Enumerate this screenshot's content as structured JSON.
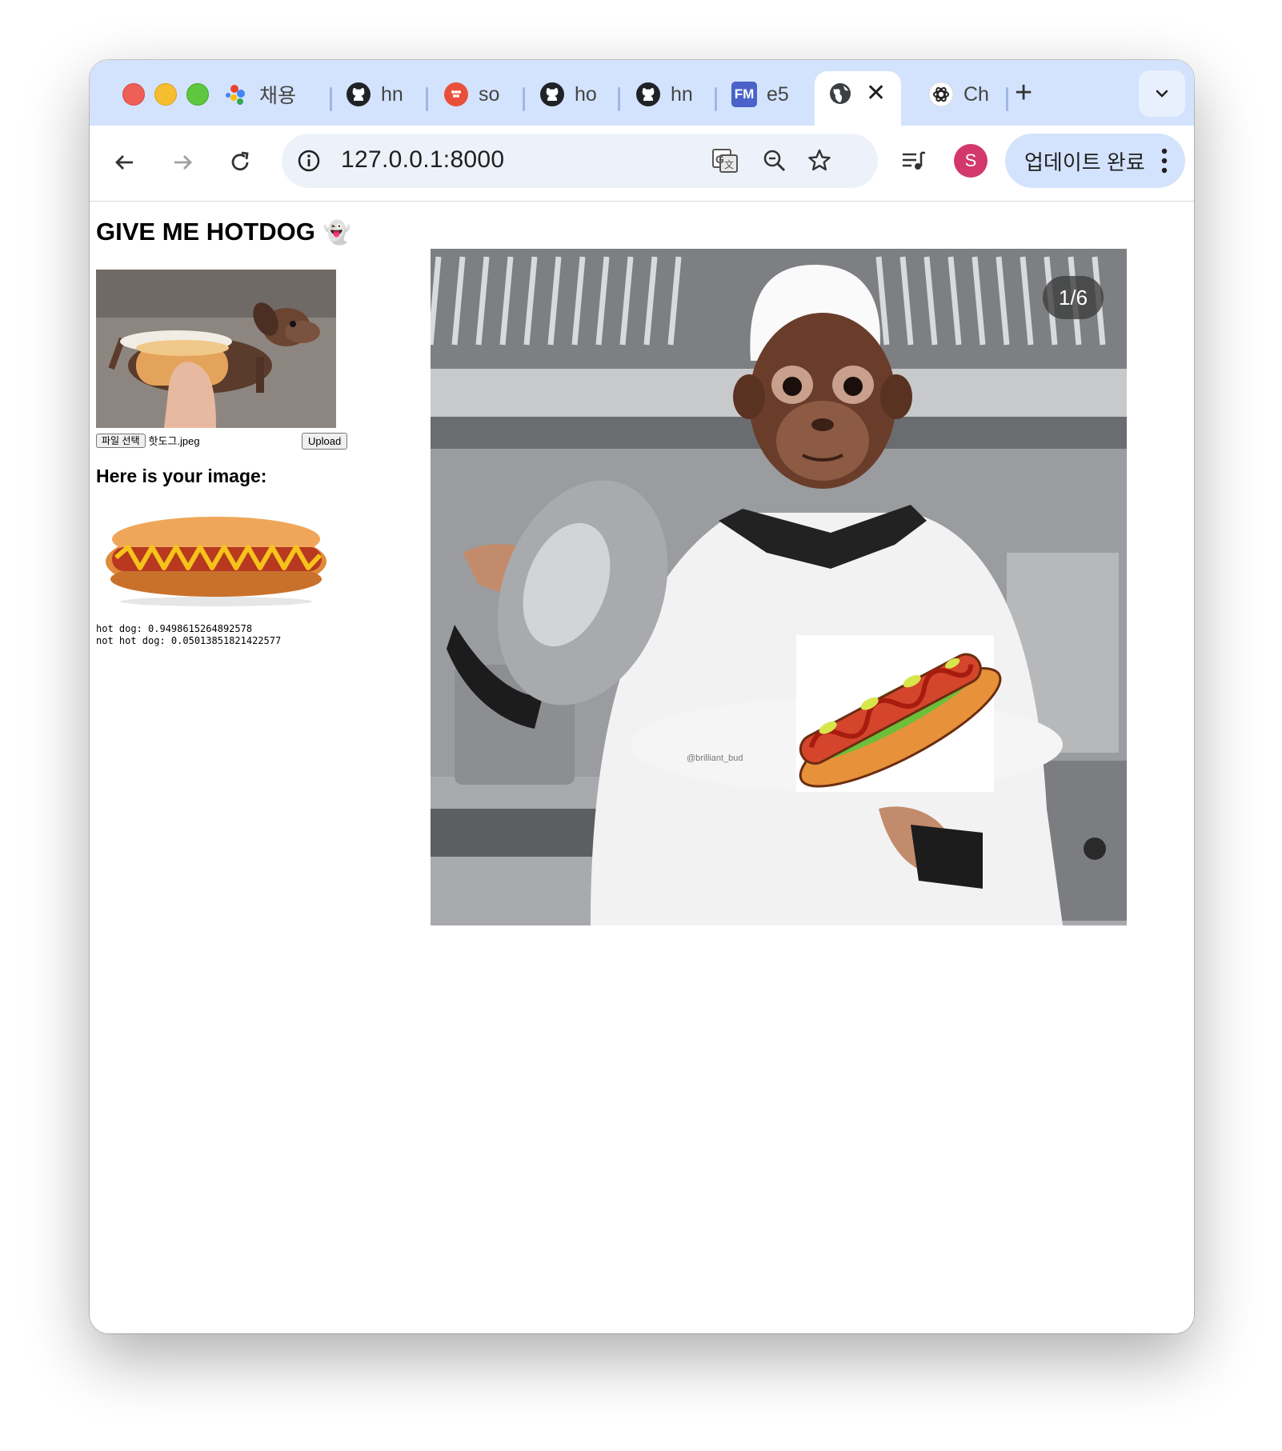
{
  "browser": {
    "tabs": [
      {
        "label": "채용",
        "icon": "google-icon"
      },
      {
        "label": "hn",
        "icon": "github-icon"
      },
      {
        "label": "so",
        "icon": "dots-app-icon"
      },
      {
        "label": "ho",
        "icon": "github-icon"
      },
      {
        "label": "hn",
        "icon": "github-icon"
      },
      {
        "label": "e5",
        "icon": "fm-icon"
      },
      {
        "label": "",
        "icon": "globe-icon",
        "active": true
      },
      {
        "label": "Ch",
        "icon": "chatgpt-icon"
      }
    ],
    "fm_badge": "FM",
    "new_tab": "+",
    "url": "127.0.0.1:8000",
    "profile_initial": "S",
    "update_label": "업데이트 완료"
  },
  "page": {
    "title": "GIVE ME HOTDOG",
    "title_emoji": "👻",
    "file_button": "파일 선택",
    "file_name": "핫도그.jpeg",
    "upload_button": "Upload",
    "result_heading": "Here is your image:",
    "score_hot_dog": "hot dog: 0.9498615264892578",
    "score_not_hot_dog": "not hot dog: 0.05013851821422577",
    "carousel_counter": "1/6",
    "watermark": "@brilliant_bud"
  },
  "colors": {
    "tabstrip": "#d3e3fd",
    "omnibox": "#edf2fa",
    "avatar": "#d2386c"
  }
}
